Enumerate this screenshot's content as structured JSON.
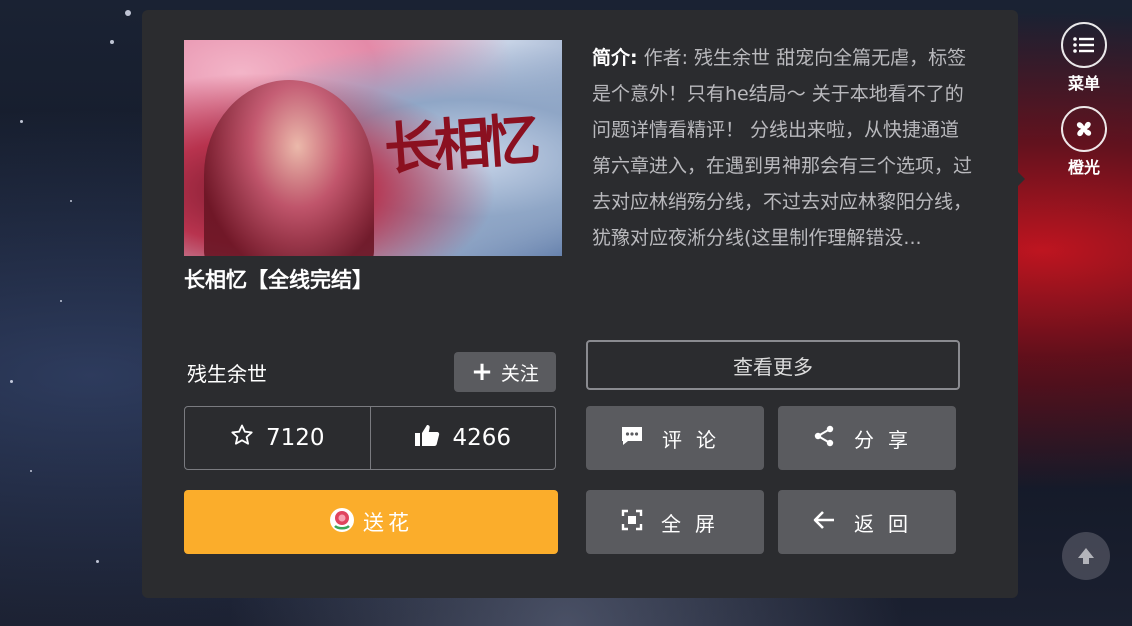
{
  "book": {
    "title": "长相忆【全线完结】",
    "cover_text": "长相忆",
    "intro_label": "简介:",
    "intro_text": "作者: 残生余世 甜宠向全篇无虐，标签是个意外！只有he结局～ 关于本地看不了的问题详情看精评！ 分线出来啦，从快捷通道第六章进入，在遇到男神那会有三个选项，过去对应林绡殇分线，不过去对应林黎阳分线，犹豫对应夜淅分线(这里制作理解错没..."
  },
  "author": {
    "name": "残生余世",
    "follow_label": "关注"
  },
  "stats": {
    "favorites": "7120",
    "likes": "4266"
  },
  "buttons": {
    "flower": "送花",
    "more": "查看更多",
    "comment": "评论",
    "share": "分享",
    "fullscreen": "全屏",
    "back": "返回"
  },
  "side": {
    "menu": "菜单",
    "theme": "橙光"
  },
  "icons": [
    "star-icon",
    "thumbs-up-icon",
    "flower-icon",
    "comment-icon",
    "share-icon",
    "fullscreen-icon",
    "back-arrow-icon",
    "menu-icon",
    "orange-light-icon",
    "plus-icon",
    "scroll-top-icon"
  ],
  "colors": {
    "panel": "#2b2c2f",
    "button": "#5a5b5f",
    "flower_button": "#fbad2b"
  }
}
